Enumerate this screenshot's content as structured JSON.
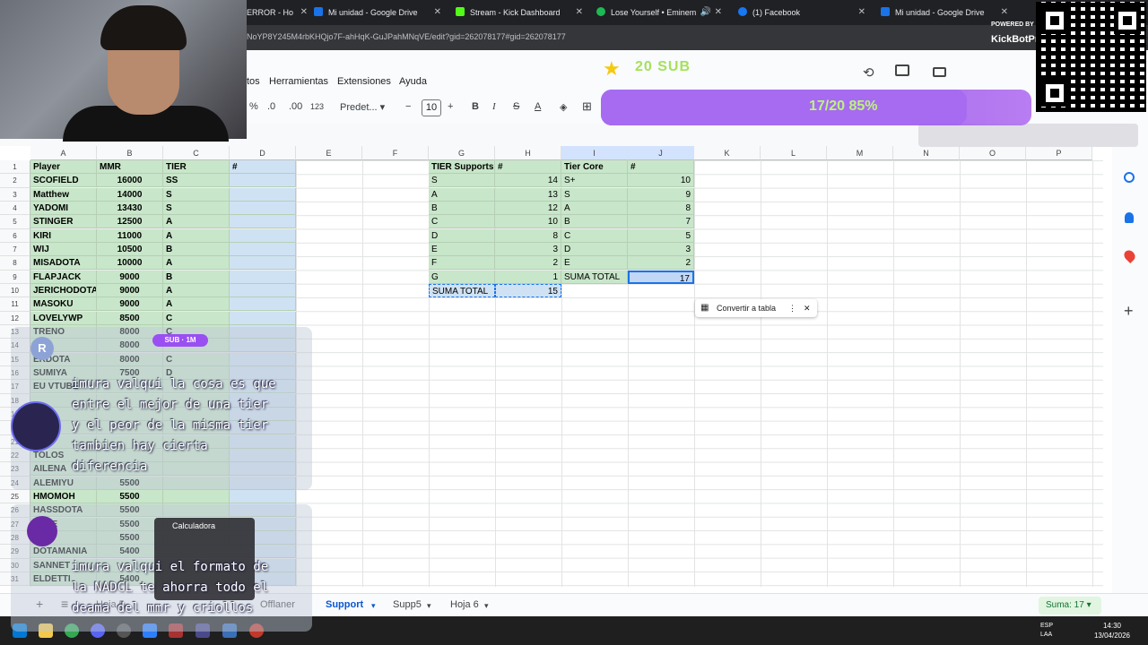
{
  "browser": {
    "tabs": [
      {
        "label": "ERROR - Ho",
        "color": "#d93025"
      },
      {
        "label": "Mi unidad - Google Drive",
        "color": "#1a73e8"
      },
      {
        "label": "Stream - Kick Dashboard",
        "color": "#53fc18"
      },
      {
        "label": "Lose Yourself • Eminem",
        "color": "#1db954"
      },
      {
        "label": "(1) Facebook",
        "color": "#1877f2"
      },
      {
        "label": "Mi unidad - Google Drive",
        "color": "#1a73e8"
      }
    ],
    "url": "NoYP8Y245M4rbKHQjo7F-ahHqK-GuJPahMNqVE/edit?gid=262078177#gid=262078177"
  },
  "menu": [
    "tos",
    "Herramientas",
    "Extensiones",
    "Ayuda"
  ],
  "toolbar": {
    "percent": "%",
    "dec_minus": ".0",
    "dec_plus": ".00",
    "num_format": "123",
    "font": "Predet...",
    "font_size": "10",
    "minus": "−",
    "plus": "+",
    "bold": "B",
    "italic": "I",
    "strike": "S",
    "text_color": "A"
  },
  "columns": [
    "A",
    "B",
    "C",
    "D",
    "E",
    "F",
    "G",
    "H",
    "I",
    "J",
    "K",
    "L",
    "M",
    "N",
    "O",
    "P"
  ],
  "rows": [
    "1",
    "2",
    "3",
    "4",
    "5",
    "6",
    "7",
    "8",
    "9",
    "10",
    "11",
    "12",
    "13",
    "14",
    "15",
    "16",
    "17",
    "18",
    "19",
    "20",
    "21",
    "22",
    "23",
    "24",
    "25",
    "26",
    "27",
    "28",
    "29",
    "30",
    "31"
  ],
  "players_header": {
    "player": "Player",
    "mmr": "MMR",
    "tier": "TIER",
    "num": "#"
  },
  "players": [
    {
      "name": "SCOFIELD",
      "mmr": "16000",
      "tier": "SS"
    },
    {
      "name": "Matthew",
      "mmr": "14000",
      "tier": "S"
    },
    {
      "name": "YADOMI",
      "mmr": "13430",
      "tier": "S"
    },
    {
      "name": "STINGER",
      "mmr": "12500",
      "tier": "A"
    },
    {
      "name": "KIRI",
      "mmr": "11000",
      "tier": "A"
    },
    {
      "name": "WIJ",
      "mmr": "10500",
      "tier": "B"
    },
    {
      "name": "MISADOTA",
      "mmr": "10000",
      "tier": "A"
    },
    {
      "name": "FLAPJACK",
      "mmr": "9000",
      "tier": "B"
    },
    {
      "name": "JERICHODOTA",
      "mmr": "9000",
      "tier": "A"
    },
    {
      "name": "MASOKU",
      "mmr": "9000",
      "tier": "A"
    },
    {
      "name": "LOVELYWP",
      "mmr": "8500",
      "tier": "C"
    },
    {
      "name": "TRENO",
      "mmr": "8000",
      "tier": "C"
    },
    {
      "name": "O",
      "mmr": "8000",
      "tier": ""
    },
    {
      "name": "ERDOTA",
      "mmr": "8000",
      "tier": "C"
    },
    {
      "name": "SUMIYA",
      "mmr": "7500",
      "tier": "D"
    },
    {
      "name": "EU VTUBE",
      "mmr": "",
      "tier": ""
    },
    {
      "name": "",
      "mmr": "",
      "tier": ""
    },
    {
      "name": "",
      "mmr": "",
      "tier": ""
    },
    {
      "name": "",
      "mmr": "",
      "tier": ""
    },
    {
      "name": "",
      "mmr": "",
      "tier": ""
    },
    {
      "name": "TOLOS",
      "mmr": "",
      "tier": ""
    },
    {
      "name": "AILENA",
      "mmr": "",
      "tier": ""
    },
    {
      "name": "ALEMIYU",
      "mmr": "5500",
      "tier": ""
    },
    {
      "name": "HMOMOH",
      "mmr": "5500",
      "tier": ""
    },
    {
      "name": "HASSDOTA",
      "mmr": "5500",
      "tier": ""
    },
    {
      "name": "ANTE",
      "mmr": "5500",
      "tier": ""
    },
    {
      "name": "HO",
      "mmr": "5500",
      "tier": ""
    },
    {
      "name": "DOTAMANIA",
      "mmr": "5400",
      "tier": ""
    },
    {
      "name": "SANNET",
      "mmr": "",
      "tier": ""
    },
    {
      "name": "ELDETTI",
      "mmr": "5400",
      "tier": ""
    }
  ],
  "supports": {
    "header": {
      "tier": "TIER Supports",
      "num": "#"
    },
    "rows": [
      {
        "tier": "S",
        "num": "14"
      },
      {
        "tier": "A",
        "num": "13"
      },
      {
        "tier": "B",
        "num": "12"
      },
      {
        "tier": "C",
        "num": "10"
      },
      {
        "tier": "D",
        "num": "8"
      },
      {
        "tier": "E",
        "num": "3"
      },
      {
        "tier": "F",
        "num": "2"
      },
      {
        "tier": "G",
        "num": "1"
      }
    ],
    "total_label": "SUMA TOTAL",
    "total": "15"
  },
  "core": {
    "header": {
      "tier": "Tier Core",
      "num": "#"
    },
    "rows": [
      {
        "tier": "S+",
        "num": "10"
      },
      {
        "tier": "S",
        "num": "9"
      },
      {
        "tier": "A",
        "num": "8"
      },
      {
        "tier": "B",
        "num": "7"
      },
      {
        "tier": "C",
        "num": "5"
      },
      {
        "tier": "D",
        "num": "3"
      },
      {
        "tier": "E",
        "num": "2"
      }
    ],
    "total_label": "SUMA TOTAL",
    "total": "17"
  },
  "convert_chip": "Convertir a tabla",
  "sheets": {
    "add": "+",
    "list_icon": "≡",
    "tabs": [
      "Hoja 5",
      "Offlaner",
      "Support",
      "Supp5",
      "Hoja 6"
    ],
    "active": "Support",
    "sum": "Suma: 17"
  },
  "overlay": {
    "goal": "20 SUB",
    "progress": "17/20  85%",
    "progress_fraction": 0.85,
    "kick_powered": "POWERED BY",
    "kick_name": "KickBotPr",
    "sub_badge": "SUB · 1M",
    "r_badge": "R",
    "chat1": "imura valqui la cosa es que\nentre el mejor de una tier\ny el peor de la misma tier\ntambien hay cierta\ndiferencia",
    "chat2": "imura valqui el formato de\nla NADCL te ahorra todo el\ndeama del mmr y criollos",
    "calc_title": "Calculadora"
  },
  "taskbar": {
    "lang": "ESP\nLAA",
    "time": "14:30",
    "date": "13/04/2026"
  }
}
